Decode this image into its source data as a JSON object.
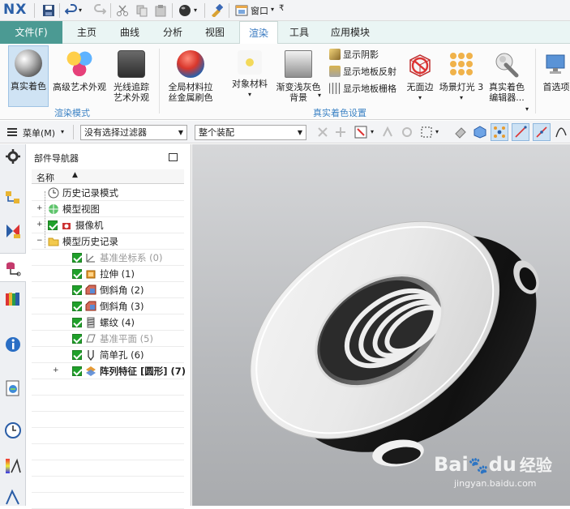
{
  "app": {
    "logo": "NX",
    "window_menu": "窗口"
  },
  "menubar": {
    "file": "文件(F)",
    "tabs": [
      "主页",
      "曲线",
      "分析",
      "视图",
      "渲染",
      "工具",
      "应用模块"
    ],
    "active": "渲染"
  },
  "ribbon": {
    "true_shading": "真实着色",
    "advanced_art": "高级艺术外观",
    "raytrace_art": "光线追踪艺术外观",
    "group_render_mode": "渲染模式",
    "global_material": "全局材料拉丝金属刷色",
    "object_material": "对象材料",
    "gradient_gray": "渐变浅灰色背景",
    "show_shadow": "显示阴影",
    "show_floor_reflect": "显示地板反射",
    "show_floor_grid": "显示地板栅格",
    "no_face": "无面边",
    "scene_light": "场景灯光 3",
    "true_shading_editor": "真实着色编辑器...",
    "group_true_shading": "真实着色设置",
    "preferences": "首选项"
  },
  "toolbar2": {
    "menu": "菜单(M)",
    "filter": "没有选择过滤器",
    "assembly": "整个装配"
  },
  "navigator": {
    "title": "部件导航器",
    "col_name": "名称",
    "rows": [
      {
        "label": "历史记录模式",
        "level": 0,
        "expand": "",
        "check": false,
        "gray": false
      },
      {
        "label": "模型视图",
        "level": 0,
        "expand": "+",
        "check": false,
        "gray": false
      },
      {
        "label": "摄像机",
        "level": 0,
        "expand": "+",
        "check": true,
        "gray": false
      },
      {
        "label": "模型历史记录",
        "level": 0,
        "expand": "−",
        "check": false,
        "gray": false
      },
      {
        "label": "基准坐标系 (0)",
        "level": 1,
        "expand": "",
        "check": true,
        "gray": true
      },
      {
        "label": "拉伸 (1)",
        "level": 1,
        "expand": "",
        "check": true,
        "gray": false
      },
      {
        "label": "倒斜角 (2)",
        "level": 1,
        "expand": "",
        "check": true,
        "gray": false
      },
      {
        "label": "倒斜角 (3)",
        "level": 1,
        "expand": "",
        "check": true,
        "gray": false
      },
      {
        "label": "螺纹 (4)",
        "level": 1,
        "expand": "",
        "check": true,
        "gray": false
      },
      {
        "label": "基准平面 (5)",
        "level": 1,
        "expand": "",
        "check": true,
        "gray": true
      },
      {
        "label": "简单孔 (6)",
        "level": 1,
        "expand": "",
        "check": true,
        "gray": false
      },
      {
        "label": "阵列特征 [圆形] (7)",
        "level": 1,
        "expand": "+",
        "check": true,
        "gray": false
      }
    ]
  },
  "watermark": {
    "brand": "Bai",
    "brand2": "du",
    "cn": "经验",
    "url": "jingyan.baidu.com"
  },
  "colors": {
    "accent": "#4b9a93",
    "tab_active": "#3778c0",
    "group_label": "#3b82c4",
    "check": "#1fa02a"
  }
}
